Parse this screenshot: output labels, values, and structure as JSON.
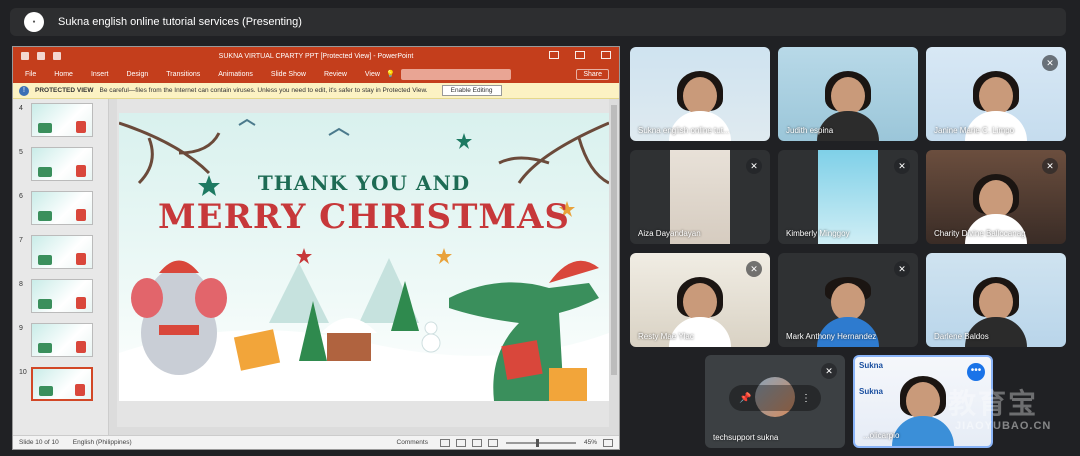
{
  "meeting": {
    "title": "Sukna english online tutorial services (Presenting)"
  },
  "ppt": {
    "doc_title": "SUKNA VIRTUAL CPARTY PPT [Protected View] - PowerPoint",
    "menu": [
      "File",
      "Home",
      "Insert",
      "Design",
      "Transitions",
      "Animations",
      "Slide Show",
      "Review",
      "View"
    ],
    "share_label": "Share",
    "protected": {
      "label": "PROTECTED VIEW",
      "message": "Be careful—files from the Internet can contain viruses. Unless you need to edit, it's safer to stay in Protected View.",
      "button": "Enable Editing"
    },
    "thumbnails": [
      "4",
      "5",
      "6",
      "7",
      "8",
      "9",
      "10"
    ],
    "slide": {
      "line1": "THANK YOU AND",
      "line2": "MERRY CHRISTMAS"
    },
    "status": {
      "slide": "Slide 10 of 10",
      "language": "English (Philippines)",
      "comments": "Comments",
      "zoom": "45%"
    }
  },
  "participants": [
    {
      "name": "Sukna english online tut..."
    },
    {
      "name": "Judith espina"
    },
    {
      "name": "Janine Marie C. Limpo"
    },
    {
      "name": "Aiza Dayandayan"
    },
    {
      "name": "Kimberly Minggoy"
    },
    {
      "name": "Charity Divine Ballocanag"
    },
    {
      "name": "Resty Mae Ylac"
    },
    {
      "name": "Mark Anthony Hernandez"
    },
    {
      "name": "Darlene Baldos"
    },
    {
      "name": "techsupport sukna"
    },
    {
      "name": "...olicarpio"
    }
  ],
  "watermark": {
    "cn": "教育宝",
    "url": "JIAOYUBAO.CN"
  },
  "colors": {
    "background": "#202124",
    "ppt_accent": "#c43e1c",
    "title_green": "#1d6b54",
    "title_red": "#c7383a",
    "speaker_border": "#8ab4f8"
  }
}
